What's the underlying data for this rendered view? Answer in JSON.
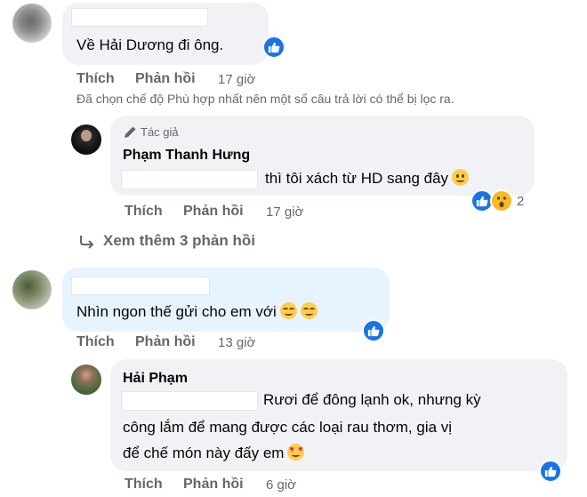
{
  "comments": [
    {
      "text": "Về Hải Dương đi ông.",
      "actions": {
        "like": "Thích",
        "reply": "Phản hồi",
        "time": "17 giờ"
      }
    },
    {
      "author_tag": "Tác giả",
      "name": "Phạm Thanh Hưng",
      "text": "thì tôi xách từ HD sang đây",
      "reaction_count": "2",
      "actions": {
        "like": "Thích",
        "reply": "Phản hồi",
        "time": "17 giờ"
      }
    },
    {
      "text": "Nhìn ngon thế gửi cho em với",
      "actions": {
        "like": "Thích",
        "reply": "Phản hồi",
        "time": "13 giờ"
      }
    },
    {
      "name": "Hải Phạm",
      "text_lines": [
        "Rươi để đông lạnh ok, nhưng kỳ",
        "công lắm để mang được các loại rau thơm, gia vị",
        "để chế món này đấy em"
      ],
      "actions": {
        "like": "Thích",
        "reply": "Phản hồi",
        "time": "6 giờ"
      }
    }
  ],
  "filter_notice": "Đã chọn chế độ Phù hợp nhất nên một số câu trả lời có thể bị lọc ra.",
  "view_more": "Xem thêm 3 phản hồi",
  "colors": {
    "like_blue": "#1b74e4",
    "bubble_gray": "#f0f2f5",
    "bubble_blue": "#e7f3ff",
    "secondary_text": "#65676b"
  },
  "icons": [
    "like-icon",
    "wow-icon",
    "pen-icon",
    "reply-arrow-icon",
    "blush-emoji",
    "smile-emoji",
    "heart-eyes-emoji"
  ]
}
